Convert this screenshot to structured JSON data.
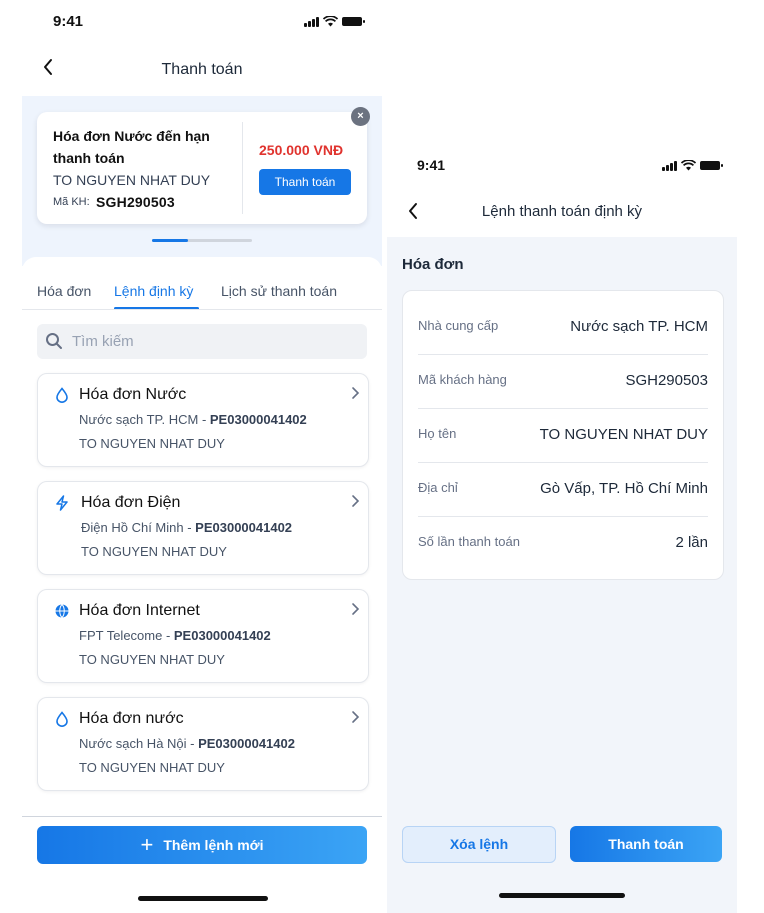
{
  "left": {
    "status": {
      "time": "9:41"
    },
    "title": "Thanh toán",
    "promo": {
      "title": "Hóa đơn Nước đến hạn thanh toán",
      "name": "TO NGUYEN NHAT DUY",
      "code_label": "Mã KH:",
      "code": "SGH290503",
      "amount": "250.000 VNĐ",
      "pay_label": "Thanh toán",
      "close_label": "×"
    },
    "tabs": [
      {
        "label": "Hóa đơn",
        "active": false
      },
      {
        "label": "Lệnh định kỳ",
        "active": true
      },
      {
        "label": "Lịch sử thanh toán",
        "active": false
      }
    ],
    "search": {
      "placeholder": "Tìm kiếm"
    },
    "bills": [
      {
        "icon": "water-drop-icon",
        "title": "Hóa đơn Nước",
        "provider": "Nước sạch TP. HCM - ",
        "code": "PE03000041402",
        "owner": "TO NGUYEN NHAT DUY"
      },
      {
        "icon": "lightning-icon",
        "title": "Hóa đơn Điện",
        "provider": "Điện Hồ Chí Minh - ",
        "code": "PE03000041402",
        "owner": "TO NGUYEN NHAT DUY"
      },
      {
        "icon": "globe-icon",
        "title": "Hóa đơn Internet",
        "provider": "FPT Telecome - ",
        "code": "PE03000041402",
        "owner": "TO NGUYEN NHAT DUY"
      },
      {
        "icon": "water-drop-icon",
        "title": "Hóa đơn nước",
        "provider": "Nước sạch Hà Nội - ",
        "code": "PE03000041402",
        "owner": "TO NGUYEN NHAT DUY"
      }
    ],
    "add_button": "Thêm lệnh mới"
  },
  "right": {
    "status": {
      "time": "9:41"
    },
    "title": "Lệnh thanh toán định kỳ",
    "section": "Hóa đơn",
    "rows": [
      {
        "label": "Nhà cung cấp",
        "value": "Nước sạch TP. HCM"
      },
      {
        "label": "Mã khách hàng",
        "value": "SGH290503"
      },
      {
        "label": "Họ tên",
        "value": "TO NGUYEN NHAT DUY"
      },
      {
        "label": "Địa chỉ",
        "value": "Gò Vấp, TP. Hồ Chí Minh"
      },
      {
        "label": "Số lần thanh toán",
        "value": "2 lần"
      }
    ],
    "delete_button": "Xóa lệnh",
    "pay_button": "Thanh toán"
  },
  "colors": {
    "accent": "#1677e6",
    "amount": "#e0332e",
    "background_tint": "#eef4fd"
  }
}
